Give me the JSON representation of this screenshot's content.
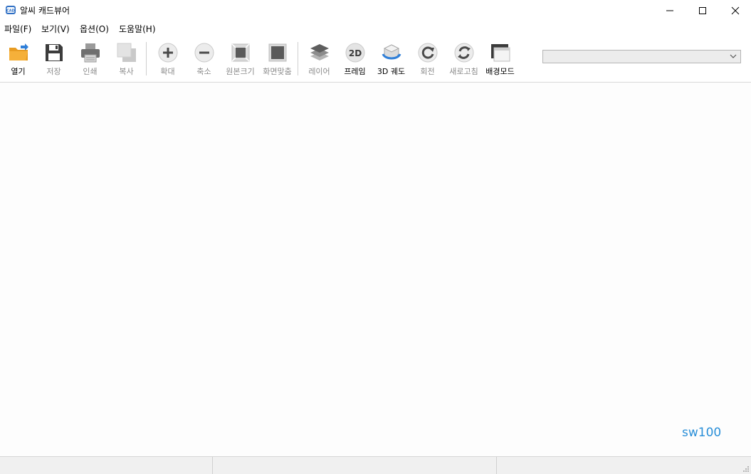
{
  "window": {
    "title": "알씨 캐드뷰어",
    "controls": [
      "minimize",
      "maximize",
      "close"
    ]
  },
  "menu": [
    {
      "label": "파일(F)"
    },
    {
      "label": "보기(V)"
    },
    {
      "label": "옵션(O)"
    },
    {
      "label": "도움말(H)"
    }
  ],
  "toolbar": {
    "open": "열기",
    "save": "저장",
    "print": "인쇄",
    "copy": "복사",
    "zoom_in": "확대",
    "zoom_out": "축소",
    "original_size": "원본크기",
    "fit_screen": "화면맞춤",
    "layer": "레이어",
    "frame": "프레임",
    "orbit_3d": "3D 궤도",
    "rotate": "회전",
    "refresh": "새로고침",
    "background_mode": "배경모드",
    "frame_icon_text": "2D"
  },
  "layout_select": {
    "value": ""
  },
  "canvas": {
    "watermark": "sw100"
  },
  "status": [
    "",
    "",
    ""
  ],
  "colors": {
    "accent": "#2a8fd8",
    "folder": "#f5b03a",
    "disabled": "#8a8a8a"
  }
}
